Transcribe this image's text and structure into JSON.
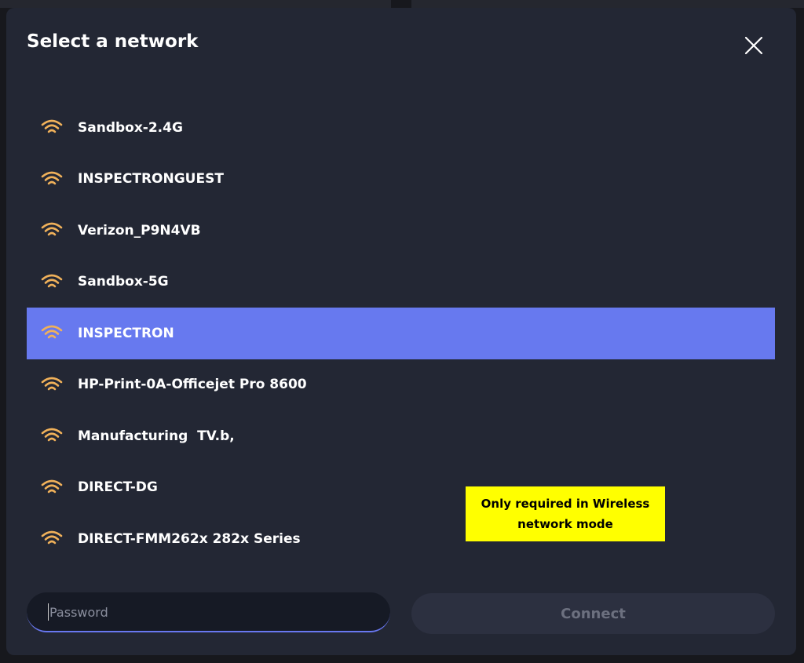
{
  "dialog": {
    "title": "Select a network",
    "close_icon": "close-icon"
  },
  "networks": [
    {
      "name": "Sandbox-2.4G",
      "icon": "wifi-icon",
      "selected": false
    },
    {
      "name": "INSPECTRONGUEST",
      "icon": "wifi-icon",
      "selected": false
    },
    {
      "name": "Verizon_P9N4VB",
      "icon": "wifi-icon",
      "selected": false
    },
    {
      "name": "Sandbox-5G",
      "icon": "wifi-icon",
      "selected": false
    },
    {
      "name": "INSPECTRON",
      "icon": "wifi-icon",
      "selected": true
    },
    {
      "name": "HP-Print-0A-Officejet Pro 8600",
      "icon": "wifi-icon",
      "selected": false
    },
    {
      "name": "Manufacturing  TV.b,",
      "icon": "wifi-icon",
      "selected": false
    },
    {
      "name": "DIRECT-DG",
      "icon": "wifi-icon",
      "selected": false
    },
    {
      "name": "DIRECT-FMM262x 282x Series",
      "icon": "wifi-icon",
      "selected": false
    }
  ],
  "annotation": {
    "text": "Only required in Wireless network mode",
    "color": "#ffff00"
  },
  "password": {
    "placeholder": "Password",
    "value": ""
  },
  "connect": {
    "label": "Connect"
  },
  "colors": {
    "dialog_bg": "#232734",
    "selected_bg": "#6779ef",
    "wifi_icon": "#f0b15a",
    "accent_underline": "#6877f0"
  }
}
